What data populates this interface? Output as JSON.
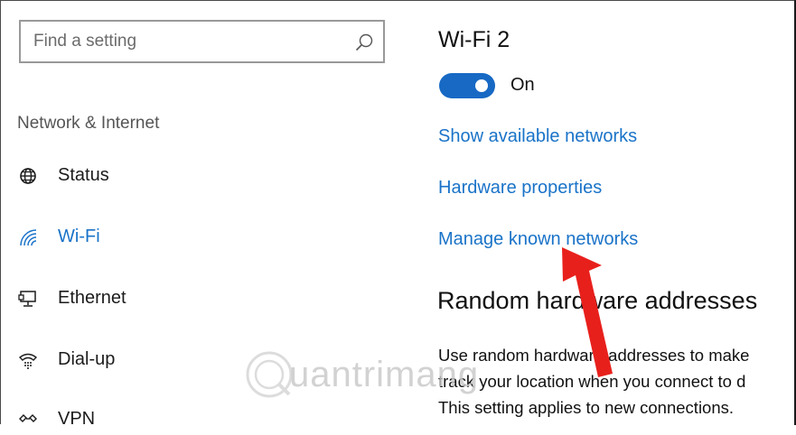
{
  "search": {
    "placeholder": "Find a setting",
    "icon": "search-icon"
  },
  "sidebar": {
    "section_title": "Network & Internet",
    "items": [
      {
        "label": "Status",
        "icon": "globe-icon",
        "active": false
      },
      {
        "label": "Wi-Fi",
        "icon": "wifi-icon",
        "active": true
      },
      {
        "label": "Ethernet",
        "icon": "ethernet-icon",
        "active": false
      },
      {
        "label": "Dial-up",
        "icon": "dialup-icon",
        "active": false
      },
      {
        "label": "VPN",
        "icon": "vpn-icon",
        "active": false
      }
    ]
  },
  "main": {
    "title": "Wi-Fi 2",
    "toggle": {
      "state": "On",
      "on": true
    },
    "links": [
      "Show available networks",
      "Hardware properties",
      "Manage known networks"
    ],
    "random_hw": {
      "heading": "Random hardware addresses",
      "lines": [
        "Use random hardware addresses to make",
        "track your location when you connect to d",
        "This setting applies to new connections."
      ]
    }
  },
  "watermark": {
    "text": "uantrimang"
  },
  "colors": {
    "accent": "#1a73c8",
    "toggle": "#1769c4",
    "arrow": "#e8201c"
  }
}
